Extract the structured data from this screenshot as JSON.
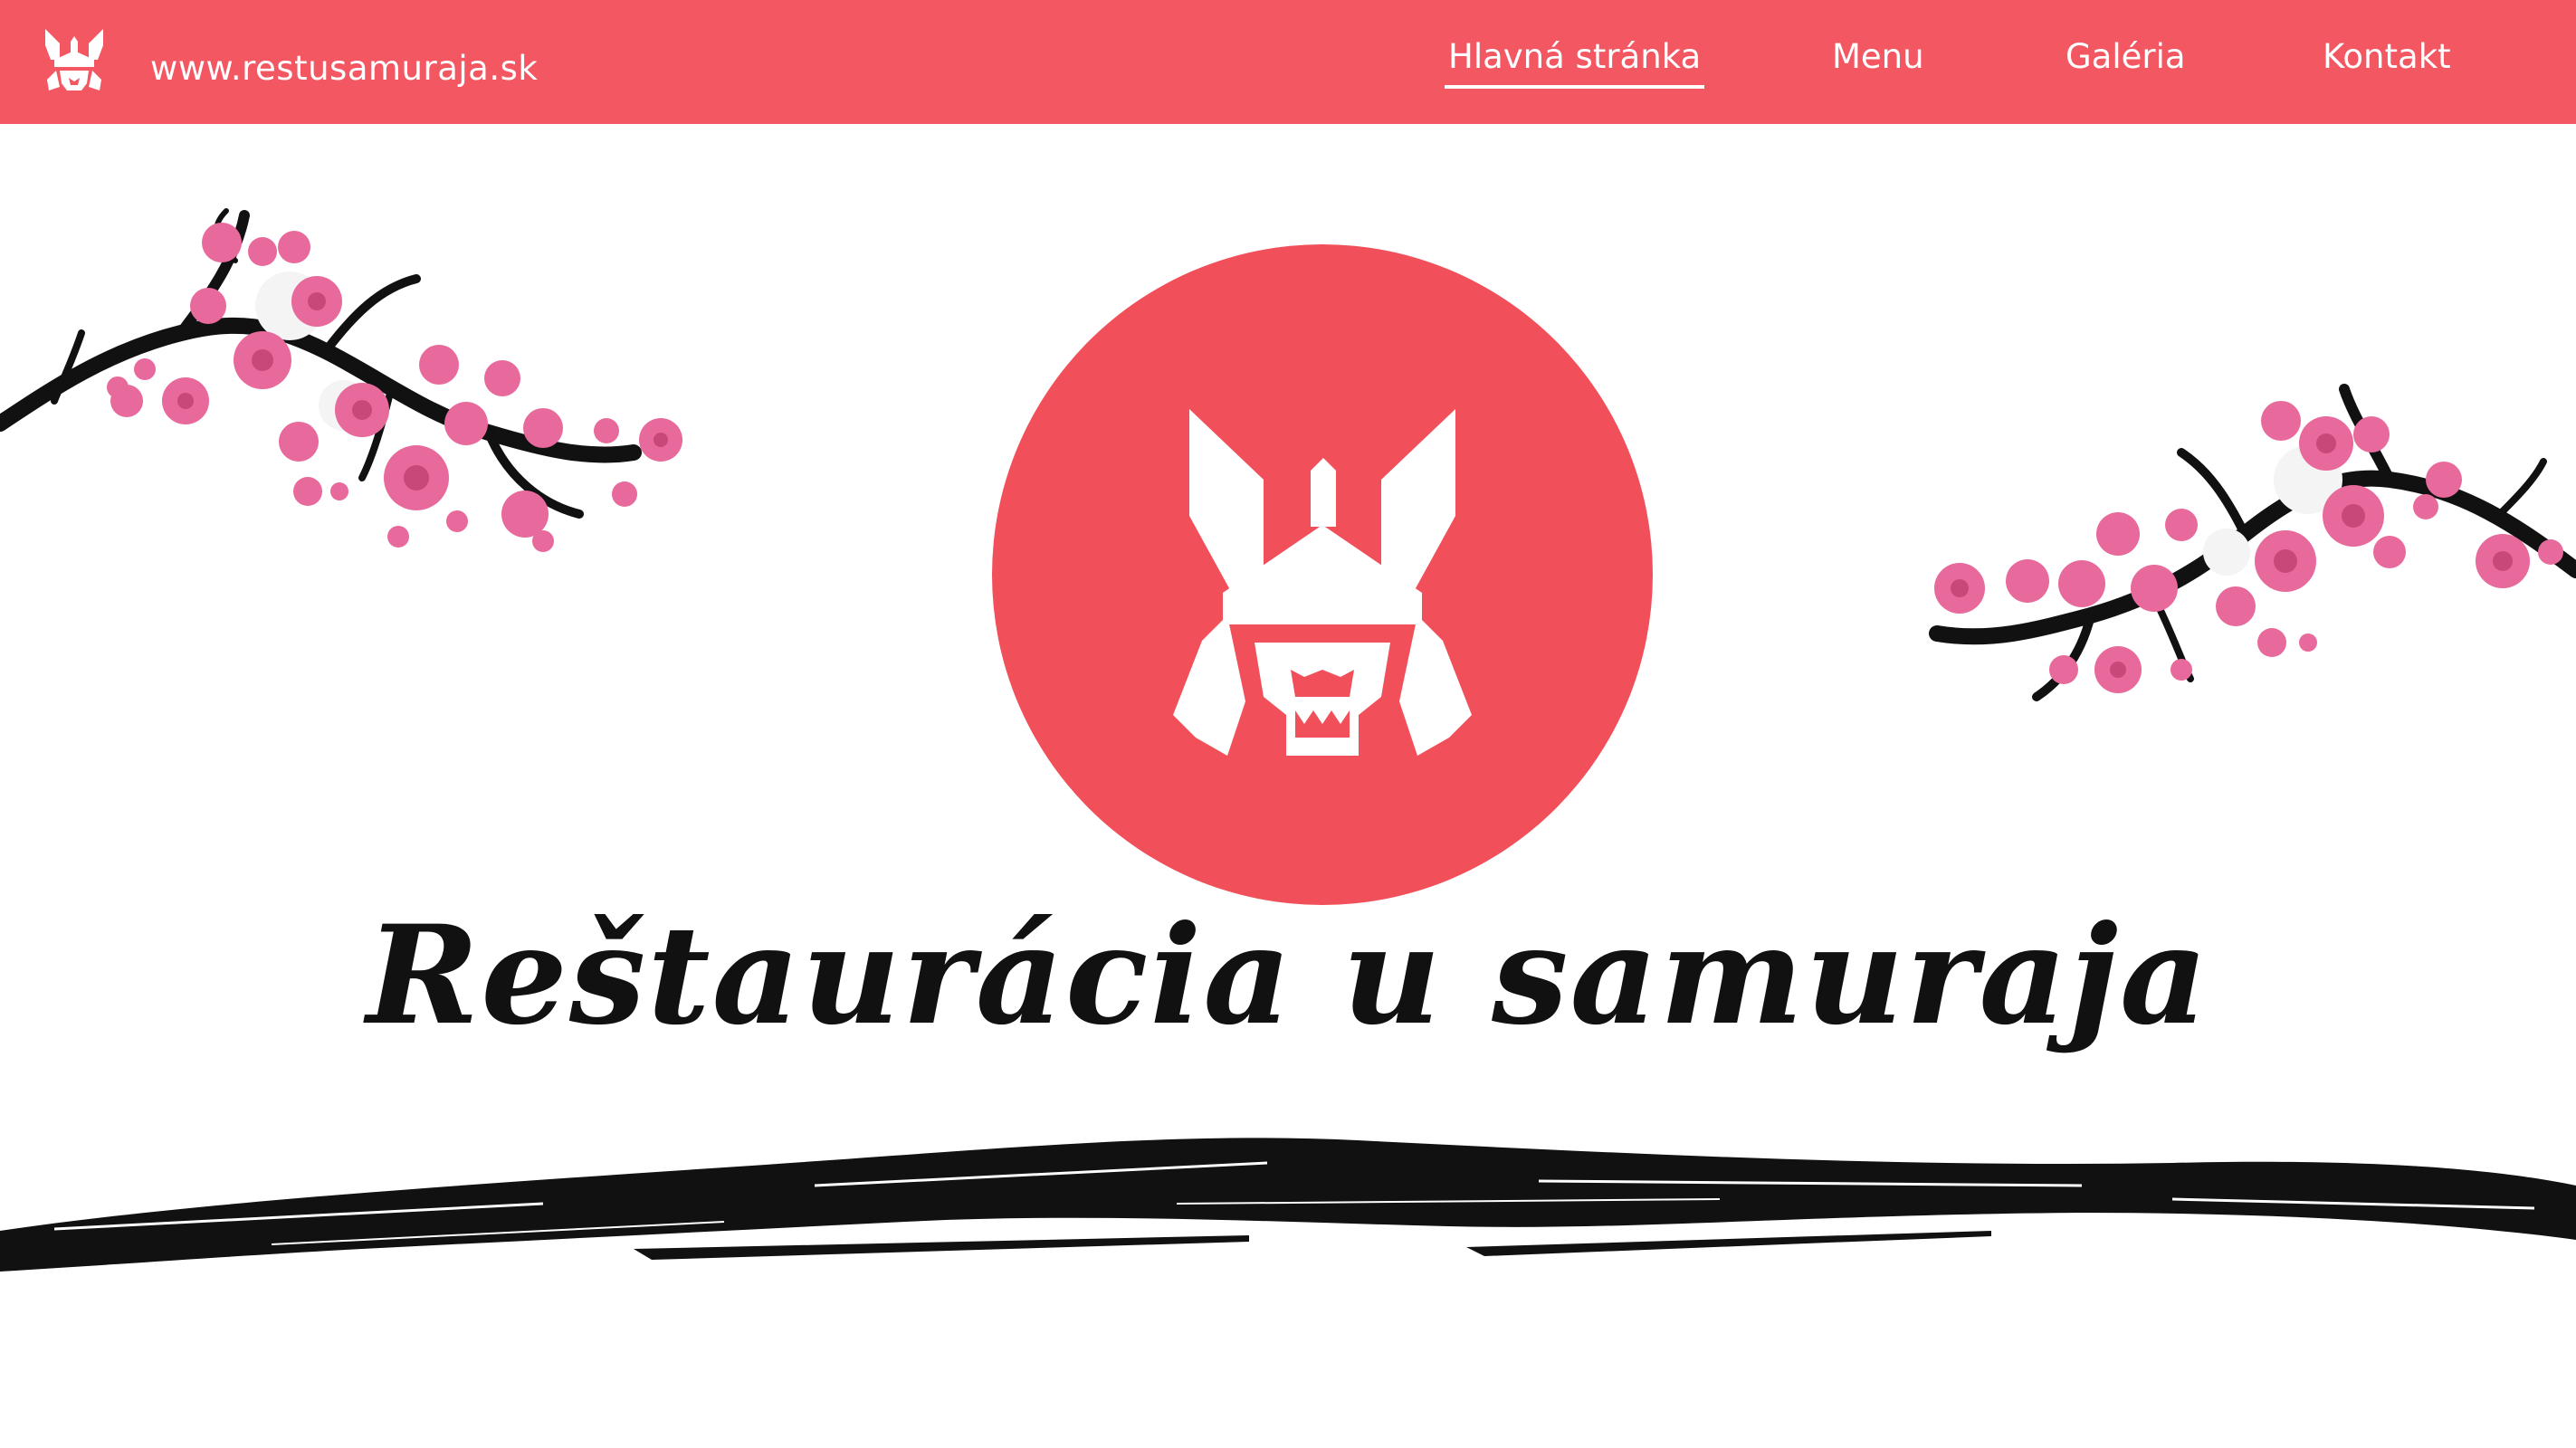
{
  "header": {
    "url": "www.restusamuraja.sk",
    "nav": [
      {
        "label": "Hlavná stránka",
        "active": true
      },
      {
        "label": "Menu",
        "active": false
      },
      {
        "label": "Galéria",
        "active": false
      },
      {
        "label": "Kontakt",
        "active": false
      }
    ]
  },
  "hero": {
    "title": "Reštaurácia u samuraja"
  },
  "colors": {
    "brand": "#f25762",
    "blossom": "#e8699c",
    "ink": "#111111"
  },
  "icons": [
    "samurai-helmet-icon",
    "cherry-blossom-branch",
    "ink-brush-stroke"
  ]
}
